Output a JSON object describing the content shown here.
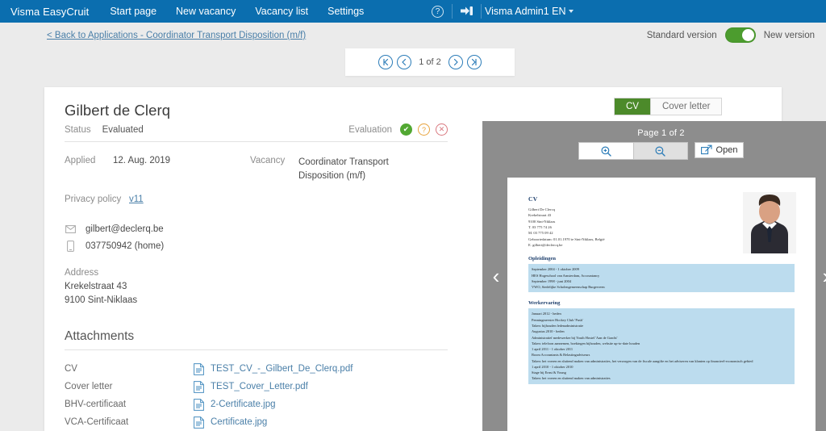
{
  "topnav": {
    "brand": "Visma EasyCruit",
    "items": [
      {
        "label": "Start page"
      },
      {
        "label": "New vacancy"
      },
      {
        "label": "Vacancy list"
      },
      {
        "label": "Settings"
      }
    ],
    "help_icon": "question-circle-icon",
    "logout_icon": "logout-icon",
    "user": "Visma Admin1 EN"
  },
  "subbar": {
    "back_link": "< Back to Applications - Coordinator Transport Disposition (m/f)",
    "standard_version_label": "Standard version",
    "new_version_label": "New version",
    "toggle_state": "new"
  },
  "pager": {
    "first_icon": "first-page-icon",
    "prev_icon": "previous-page-icon",
    "position": "1 of 2",
    "next_icon": "next-page-icon",
    "last_icon": "last-page-icon"
  },
  "candidate": {
    "name": "Gilbert de Clerq",
    "status_label": "Status",
    "status_value": "Evaluated",
    "evaluation_label": "Evaluation",
    "evaluation": {
      "yes_icon": "check-icon",
      "maybe_icon": "question-icon",
      "no_icon": "cross-icon"
    },
    "applied_label": "Applied",
    "applied_value": "12. Aug. 2019",
    "vacancy_label": "Vacancy",
    "vacancy_value": "Coordinator Transport Disposition (m/f)",
    "privacy_label": "Privacy policy",
    "privacy_value": "v11",
    "email": "gilbert@declerq.be",
    "phone": "037750942 (home)",
    "address_label": "Address",
    "address_line1": "Krekelstraat 43",
    "address_line2": "9100 Sint-Niklaas"
  },
  "attachments": {
    "heading": "Attachments",
    "rows": [
      {
        "type": "CV",
        "file": "TEST_CV_-_Gilbert_De_Clerq.pdf"
      },
      {
        "type": "Cover letter",
        "file": "TEST_Cover_Letter.pdf"
      },
      {
        "type": "BHV-certificaat",
        "file": "2-Certificate.jpg"
      },
      {
        "type": "VCA-Certificaat",
        "file": "Certificate.jpg"
      }
    ]
  },
  "viewer": {
    "tab_cv": "CV",
    "tab_cover": "Cover letter",
    "page_label": "Page 1 of 2",
    "zoom_in_icon": "zoom-in-icon",
    "zoom_out_icon": "zoom-out-icon",
    "open_label": "Open",
    "open_icon": "external-link-icon",
    "prev_doc_icon": "chevron-left-icon",
    "next_doc_icon": "chevron-right-icon",
    "document": {
      "title": "CV",
      "address_block": "Gilbert De Clercq\nKrekelstraat 43\n9100 Sint-Niklaas\nT. 03 775 74 26\nM. 03 775 09 42\nGeboortedatum: 01.01.1970 te Sint-Niklaas, België\nE. gilbert@declercq.be",
      "photo_icon": "candidate-photo",
      "sections": [
        {
          "heading": "Opleidingen",
          "body": "September 2004 - 1 oktober 2009\nHES Hogeschool van Amsterdam, Accountancy\nSeptember 1998 - juni 2004\nVWO, Stedelijke Scholengemeenschap Burgerveen"
        },
        {
          "heading": "Werkervaring",
          "body": "Januari 2012 - heden\nPenningmeester Hockey Club 'Push'\nTaken: bijhouden ledenadministratie\nAugustus 2010 - heden\nAdministratief medewerker bij Youth Hostel 'Aan de Gracht'\nTaken: telefoon aannemen, boekingen bijhouden, website up-to-date houden\n1 april 2011 - 1 oktober 2011\nBoom Accountants & Belastingadviseurs\nTaken: het voeren en sluitend maken van administraties, het verzorgen van de fiscale aangifte en het adviseren van klanten op financieel-economisch gebied\n1 april 2010 - 1 oktober 2010\nStage bij Ernst & Young\nTaken: het voeren en sluitend maken van administraties"
        }
      ]
    }
  },
  "colors": {
    "nav_blue": "#0b6eaf",
    "accent_green": "#4c9c2e",
    "link_blue": "#4a7fa8",
    "page_bg": "#ebebeb"
  }
}
